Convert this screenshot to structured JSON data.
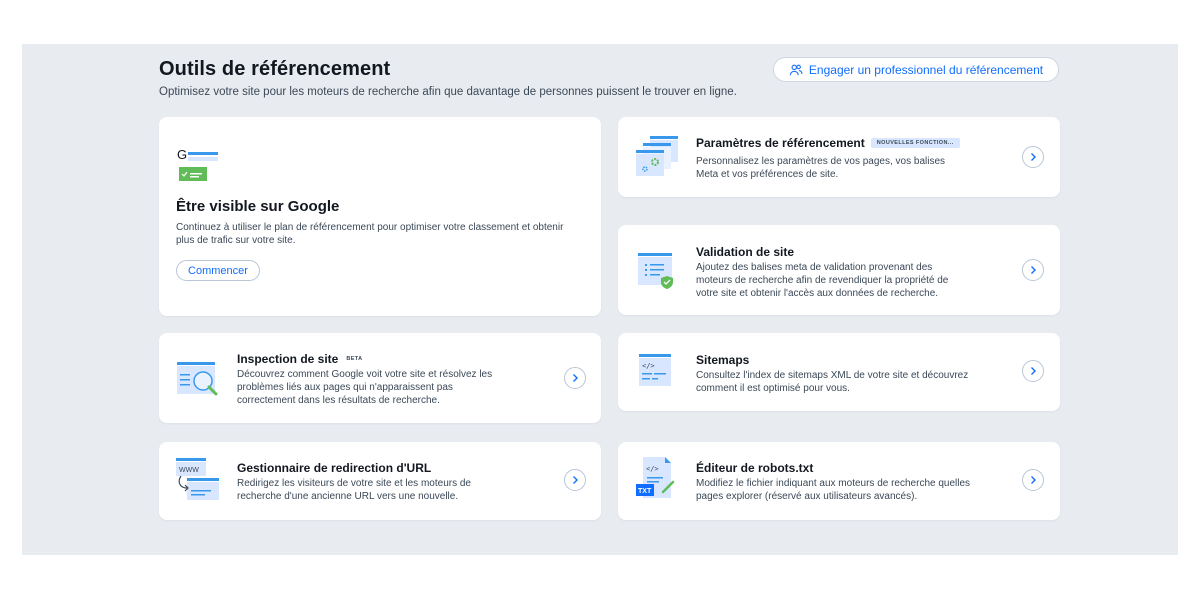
{
  "header": {
    "title": "Outils de référencement",
    "subtitle": "Optimisez votre site pour les moteurs de recherche afin que davantage de personnes puissent le trouver en ligne.",
    "pro_button": "Engager un professionnel du référencement"
  },
  "hero": {
    "title": "Être visible sur Google",
    "description": "Continuez à utiliser le plan de référencement pour optimiser votre classement et obtenir plus de trafic sur votre site.",
    "button": "Commencer"
  },
  "cards": {
    "seo_settings": {
      "title": "Paramètres de référencement",
      "badge": "NOUVELLES FONCTION...",
      "description": "Personnalisez les paramètres de vos pages, vos balises Meta et vos préférences de site."
    },
    "site_verification": {
      "title": "Validation de site",
      "description": "Ajoutez des balises meta de validation provenant des moteurs de recherche afin de revendiquer la propriété de votre site et obtenir l'accès aux données de recherche."
    },
    "site_inspection": {
      "title": "Inspection de site",
      "badge": "BETA",
      "description": "Découvrez comment Google voit votre site et résolvez les problèmes liés aux pages qui n'apparaissent pas correctement dans les résultats de recherche."
    },
    "sitemaps": {
      "title": "Sitemaps",
      "description": "Consultez l'index de sitemaps XML de votre site et découvrez comment il est optimisé pour vous."
    },
    "redirects": {
      "title": "Gestionnaire de redirection d'URL",
      "description": "Redirigez les visiteurs de votre site et les moteurs de recherche d'une ancienne URL vers une nouvelle."
    },
    "robots": {
      "title": "Éditeur de robots.txt",
      "description": "Modifiez le fichier indiquant aux moteurs de recherche quelles pages explorer (réservé aux utilisateurs avancés)."
    }
  },
  "icons": {
    "g_letter": "G",
    "code_tag": "</>",
    "www": "WWW",
    "txt": "TXT"
  },
  "colors": {
    "accent": "#116dff",
    "panel_bg": "#e8ecf1",
    "icon_blue": "#3899ec",
    "icon_light": "#d8e6ff",
    "icon_green": "#60bc57"
  }
}
